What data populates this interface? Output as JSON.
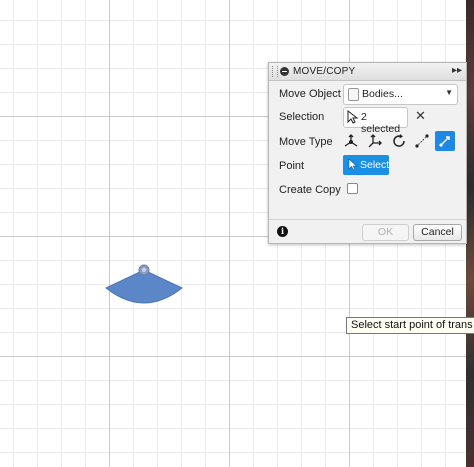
{
  "dialog": {
    "title": "MOVE/COPY",
    "rows": {
      "move_object": {
        "label": "Move Object",
        "value": "Bodies...",
        "icon": "body-icon"
      },
      "selection": {
        "label": "Selection",
        "value": "2 selected",
        "icon": "cursor-arrow-icon",
        "clear_icon": "close-icon",
        "clear_glyph": "✕"
      },
      "move_type": {
        "label": "Move Type",
        "options": [
          {
            "name": "free-move-icon",
            "active": false
          },
          {
            "name": "translate-xyz-icon",
            "active": false
          },
          {
            "name": "rotate-icon",
            "active": false
          },
          {
            "name": "point-to-point-icon",
            "active": false
          },
          {
            "name": "point-to-position-icon",
            "active": true
          }
        ]
      },
      "point": {
        "label": "Point",
        "button": "Select",
        "icon": "cursor-arrow-icon"
      },
      "create_copy": {
        "label": "Create Copy",
        "checked": false
      }
    },
    "footer": {
      "info_glyph": "i",
      "ok": "OK",
      "ok_enabled": false,
      "cancel": "Cancel"
    }
  },
  "tooltip": {
    "text": "Select start point of trans"
  },
  "colors": {
    "accent": "#1a8fe3",
    "body_fill": "#5b87c8",
    "grid_minor": "#ececec",
    "grid_major": "#c9c9c9"
  }
}
